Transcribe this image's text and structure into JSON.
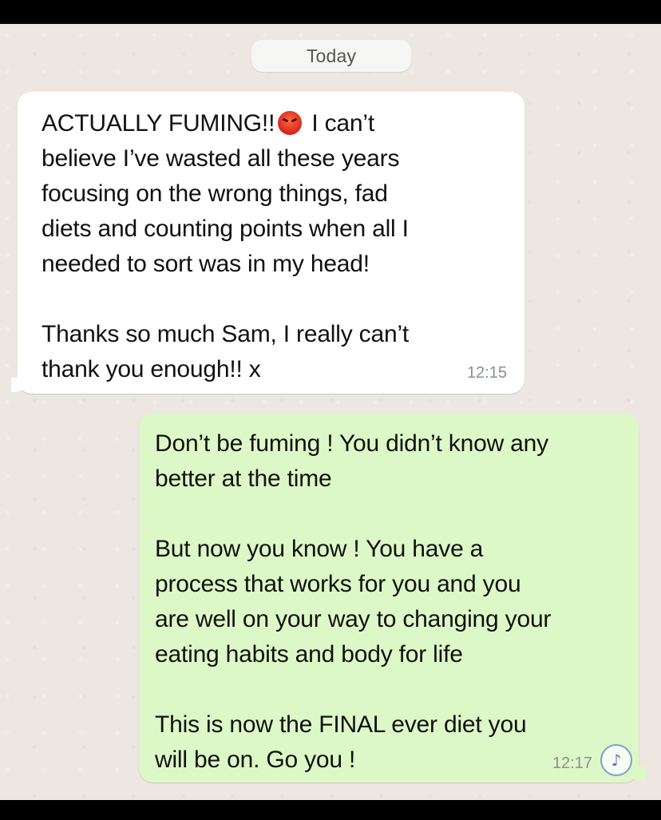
{
  "chat": {
    "date_label": "Today",
    "messages": [
      {
        "direction": "incoming",
        "text_before_emoji": "ACTUALLY FUMING!!",
        "emoji": "pouting-face-icon",
        "text_after_emoji": " I can’t\nbelieve I’ve wasted all these years\nfocusing on the wrong things, fad\ndiets and counting points when all I\nneeded to sort was in my head!\n\nThanks so much Sam, I really can’t\nthank you enough!! x",
        "time": "12:15"
      },
      {
        "direction": "outgoing",
        "text": "Don’t be fuming ! You didn’t know any\nbetter at the time\n\nBut now you know ! You have a\nprocess that works for you and you\nare well on your way to changing your\neating habits and body for life\n\nThis is now the FINAL ever diet you\nwill be on. Go you !",
        "time": "12:17"
      }
    ]
  },
  "overlay": {
    "badge_icon": "music-note-icon",
    "badge_glyph": "♪"
  },
  "colors": {
    "chat_background": "#ece8e1",
    "incoming_bubble": "#ffffff",
    "outgoing_bubble": "#dcf8c6",
    "timestamp": "#8a8f96"
  }
}
